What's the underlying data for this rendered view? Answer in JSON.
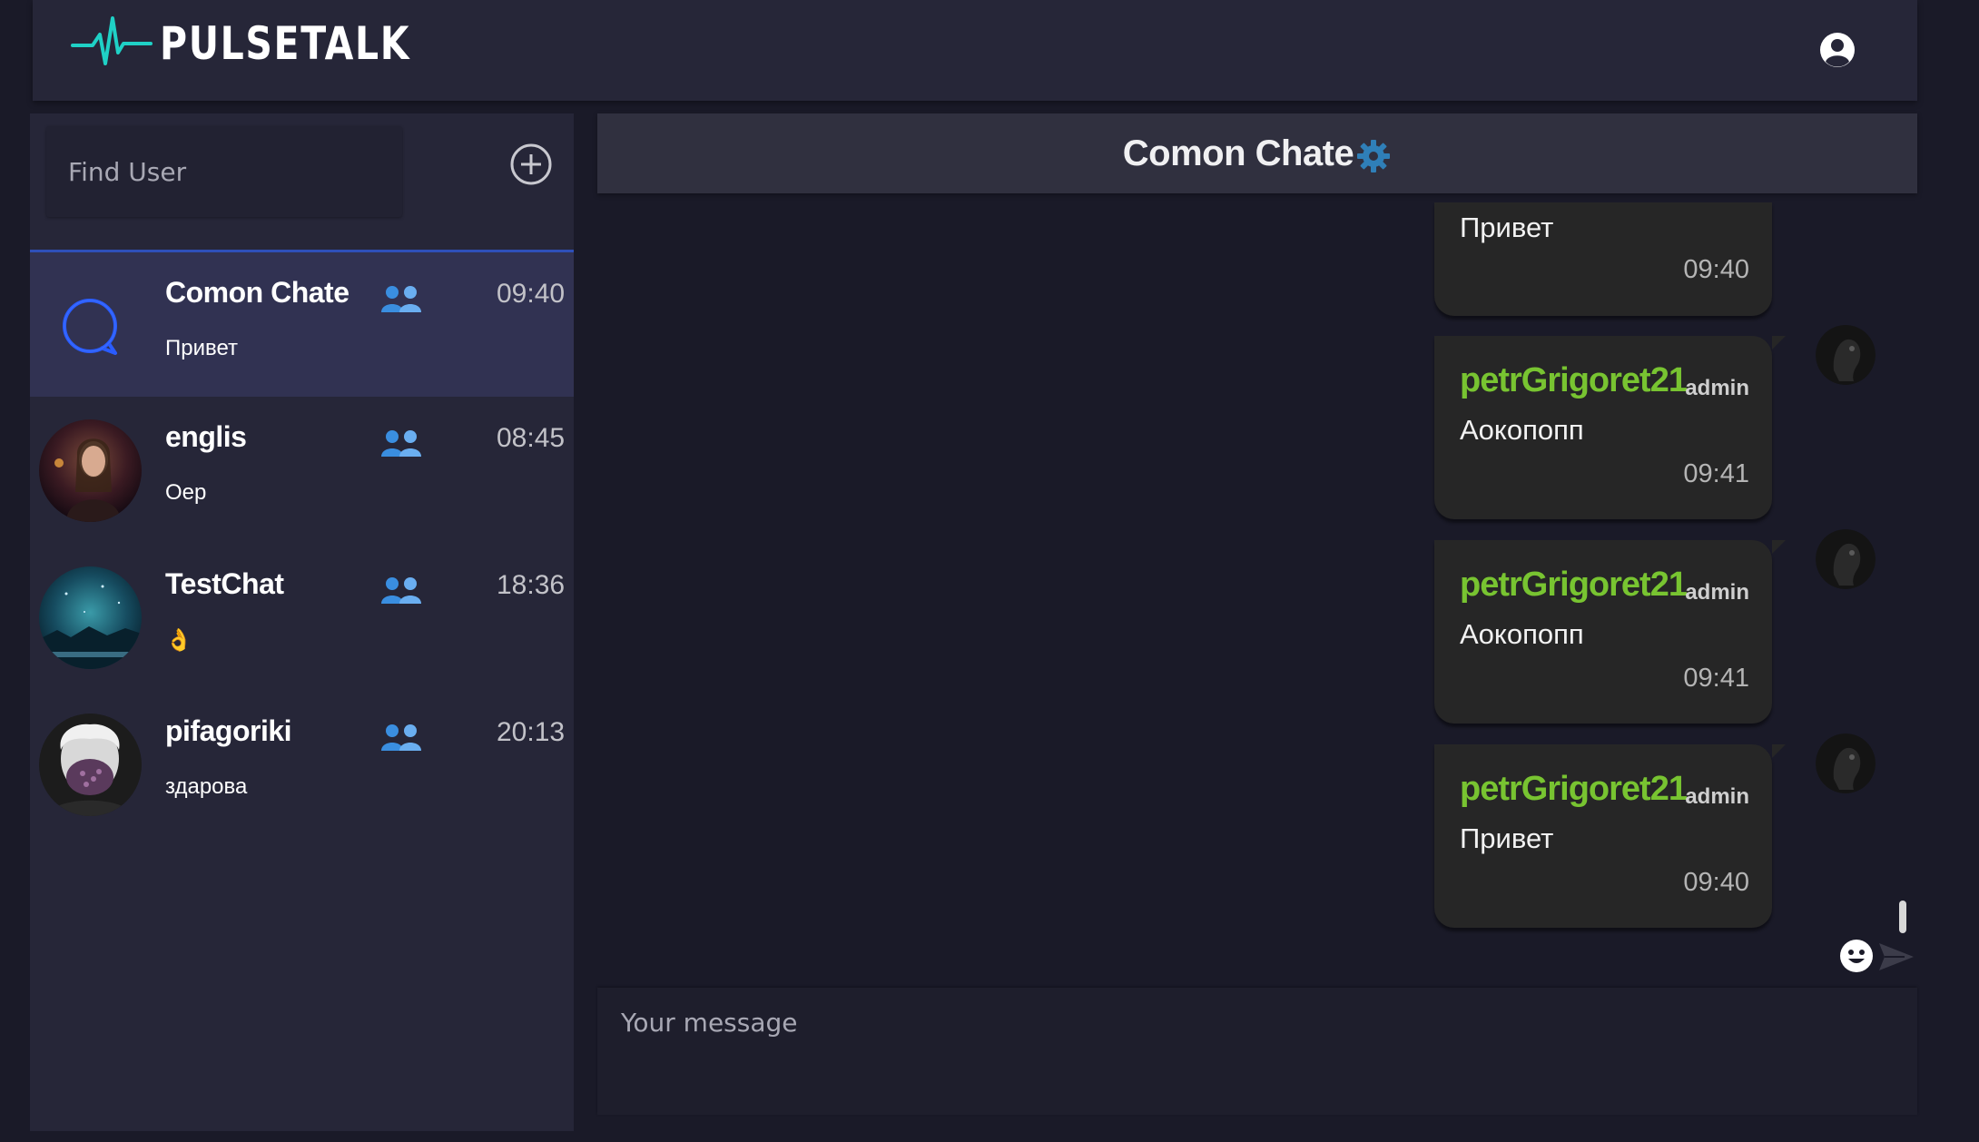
{
  "brand": {
    "name": "PULSETALK",
    "accent": "#1fd1c6"
  },
  "header": {
    "profile_icon": "user-circle-icon"
  },
  "sidebar": {
    "search": {
      "placeholder": "Find User",
      "value": ""
    },
    "add_icon": "plus-circle-icon",
    "chats": [
      {
        "name": "Comon Chate",
        "time": "09:40",
        "last": "Привет",
        "type": "group",
        "active": true,
        "avatar": "chat-bubble-icon"
      },
      {
        "name": "englis",
        "time": "08:45",
        "last": "Оер",
        "type": "group",
        "active": false,
        "avatar": "photo-avatar"
      },
      {
        "name": "TestChat",
        "time": "18:36",
        "last": "👌",
        "type": "group",
        "active": false,
        "avatar": "photo-avatar"
      },
      {
        "name": "pifagoriki",
        "time": "20:13",
        "last": "здарова",
        "type": "group",
        "active": false,
        "avatar": "photo-avatar"
      }
    ]
  },
  "chat": {
    "title": "Comon Chate",
    "settings_icon": "gear-icon",
    "messages": [
      {
        "text": "Привет",
        "time": "09:40"
      },
      {
        "sender": "petrGrigoret21",
        "role": "admin",
        "text": "Аокопопп",
        "time": "09:41"
      },
      {
        "sender": "petrGrigoret21",
        "role": "admin",
        "text": "Аокопопп",
        "time": "09:41"
      },
      {
        "sender": "petrGrigoret21",
        "role": "admin",
        "text": "Привет",
        "time": "09:40"
      }
    ],
    "composer": {
      "placeholder": "Your message",
      "value": ""
    },
    "emoji_icon": "smiley-icon",
    "send_icon": "send-icon"
  },
  "colors": {
    "background": "#1a1a28",
    "panel": "#262638",
    "active_chat": "#313252",
    "active_border": "#2e4fb8",
    "sender_name": "#78c431",
    "group_icon": "#3a8ee0",
    "bubble": "#262626"
  }
}
